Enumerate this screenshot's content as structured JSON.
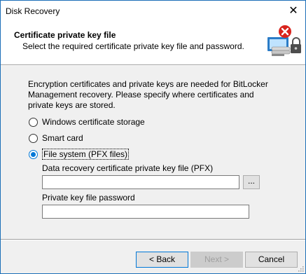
{
  "window": {
    "title": "Disk Recovery"
  },
  "header": {
    "title": "Certificate private key file",
    "subtitle": "Select the required certificate private key file and password.",
    "icon": "certificate-lock-icon"
  },
  "description": "Encryption certificates and private keys are needed for BitLocker Management recovery. Please specify where certificates and private keys are stored.",
  "options": [
    {
      "label": "Windows certificate storage",
      "selected": false
    },
    {
      "label": "Smart card",
      "selected": false
    },
    {
      "label": "File system (PFX files)",
      "selected": true
    }
  ],
  "pfx": {
    "label": "Data recovery certificate private key file (PFX)",
    "value": "",
    "browse_label": "..."
  },
  "password": {
    "label": "Private key file password",
    "value": ""
  },
  "buttons": {
    "back": "< Back",
    "next": "Next >",
    "cancel": "Cancel"
  },
  "colors": {
    "accent": "#0078d7",
    "dialog_bg": "#f0f0f0",
    "window_border": "#1c6fb8"
  }
}
